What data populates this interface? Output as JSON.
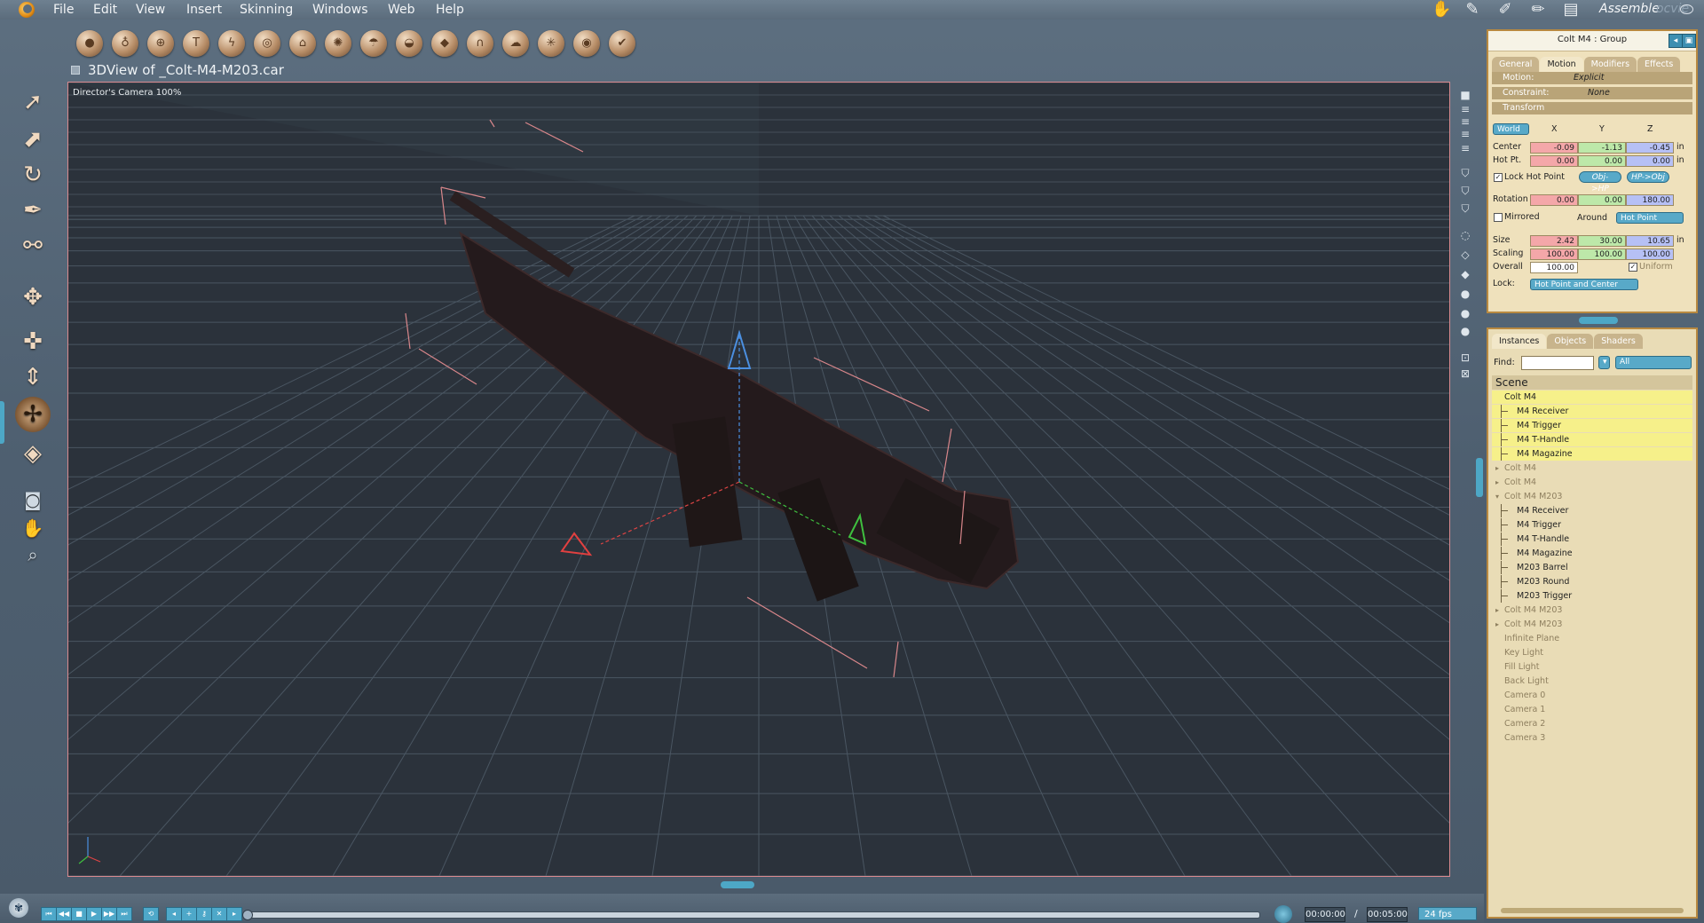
{
  "menu": [
    "File",
    "Edit",
    "View",
    "Insert",
    "Skinning",
    "Windows",
    "Web",
    "Help"
  ],
  "mode": {
    "label": "Assemble",
    "aux": "ocvie"
  },
  "toolbar_icons": [
    "sphere-icon",
    "cup-icon",
    "globe-icon",
    "text-icon",
    "flame-icon",
    "eye-lens-icon",
    "tube-icon",
    "gear-ball-icon",
    "umbrella-icon",
    "dome-icon",
    "pill-icon",
    "arch-icon",
    "cloud-icon",
    "sparkle-icon",
    "target-icon",
    "wrench-icon"
  ],
  "view": {
    "title": "3DView of _Colt-M4-M203.car",
    "camera_label": "Director's Camera 100%"
  },
  "props": {
    "header": "Colt M4 : Group",
    "tabs": [
      "General",
      "Motion",
      "Modifiers",
      "Effects"
    ],
    "active_tab": "Motion",
    "motion": {
      "label": "Motion:",
      "value": "Explicit"
    },
    "constraint": {
      "label": "Constraint:",
      "value": "None"
    },
    "transform_label": "Transform",
    "space": "World",
    "axes": [
      "X",
      "Y",
      "Z"
    ],
    "center": {
      "label": "Center",
      "x": "-0.09",
      "y": "-1.13",
      "z": "-0.45",
      "unit": "in"
    },
    "hotpt": {
      "label": "Hot Pt.",
      "x": "0.00",
      "y": "0.00",
      "z": "0.00",
      "unit": "in"
    },
    "lock_hot_point": "Lock Hot Point",
    "obj_hp": "Obj->HP",
    "hp_obj": "HP->Obj",
    "rotation": {
      "label": "Rotation",
      "x": "0.00",
      "y": "0.00",
      "z": "180.00"
    },
    "mirrored": "Mirrored",
    "around": "Around",
    "around_value": "Hot Point",
    "size": {
      "label": "Size",
      "x": "2.42",
      "y": "30.00",
      "z": "10.65",
      "unit": "in"
    },
    "scaling": {
      "label": "Scaling",
      "x": "100.00",
      "y": "100.00",
      "z": "100.00"
    },
    "overall": {
      "label": "Overall",
      "value": "100.00"
    },
    "uniform": "Uniform",
    "lock": {
      "label": "Lock:",
      "value": "Hot Point and Center"
    }
  },
  "scene": {
    "tabs": [
      "Instances",
      "Objects",
      "Shaders"
    ],
    "active_tab": "Instances",
    "find_label": "Find:",
    "filter": "All",
    "root": "Scene",
    "nodes": [
      {
        "label": "Colt M4",
        "level": 0,
        "state": "sel",
        "arrow": ""
      },
      {
        "label": "M4 Receiver",
        "level": 1,
        "state": "sel",
        "arrow": ""
      },
      {
        "label": "M4 Trigger",
        "level": 1,
        "state": "sel",
        "arrow": ""
      },
      {
        "label": "M4 T-Handle",
        "level": 1,
        "state": "sel",
        "arrow": ""
      },
      {
        "label": "M4 Magazine",
        "level": 1,
        "state": "sel",
        "arrow": ""
      },
      {
        "label": "Colt M4",
        "level": 0,
        "state": "dim",
        "arrow": "▸"
      },
      {
        "label": "Colt M4",
        "level": 0,
        "state": "dim",
        "arrow": "▸"
      },
      {
        "label": "Colt M4 M203",
        "level": 0,
        "state": "dim",
        "arrow": "▾"
      },
      {
        "label": "M4 Receiver",
        "level": 1,
        "state": "norm",
        "arrow": ""
      },
      {
        "label": "M4 Trigger",
        "level": 1,
        "state": "norm",
        "arrow": ""
      },
      {
        "label": "M4 T-Handle",
        "level": 1,
        "state": "norm",
        "arrow": ""
      },
      {
        "label": "M4 Magazine",
        "level": 1,
        "state": "norm",
        "arrow": ""
      },
      {
        "label": "M203 Barrel",
        "level": 1,
        "state": "norm",
        "arrow": ""
      },
      {
        "label": "M203 Round",
        "level": 1,
        "state": "norm",
        "arrow": ""
      },
      {
        "label": "M203 Trigger",
        "level": 1,
        "state": "norm",
        "arrow": ""
      },
      {
        "label": "Colt M4 M203",
        "level": 0,
        "state": "dim",
        "arrow": "▸"
      },
      {
        "label": "Colt M4 M203",
        "level": 0,
        "state": "dim",
        "arrow": "▸"
      },
      {
        "label": "Infinite Plane",
        "level": 0,
        "state": "dim",
        "arrow": ""
      },
      {
        "label": "Key Light",
        "level": 0,
        "state": "dim",
        "arrow": ""
      },
      {
        "label": "Fill Light",
        "level": 0,
        "state": "dim",
        "arrow": ""
      },
      {
        "label": "Back Light",
        "level": 0,
        "state": "dim",
        "arrow": ""
      },
      {
        "label": "Camera 0",
        "level": 0,
        "state": "dim",
        "arrow": ""
      },
      {
        "label": "Camera 1",
        "level": 0,
        "state": "dim",
        "arrow": ""
      },
      {
        "label": "Camera 2",
        "level": 0,
        "state": "dim",
        "arrow": ""
      },
      {
        "label": "Camera 3",
        "level": 0,
        "state": "dim",
        "arrow": ""
      }
    ]
  },
  "timeline": {
    "current": "00:00:00",
    "separator": "/",
    "end": "00:05:00",
    "fps": "24 fps"
  },
  "colors": {
    "accent": "#4da7c6",
    "panel": "#efe1bc",
    "panel_border": "#b88940",
    "viewport": "#2b323b",
    "selection": "#f6f08a"
  }
}
